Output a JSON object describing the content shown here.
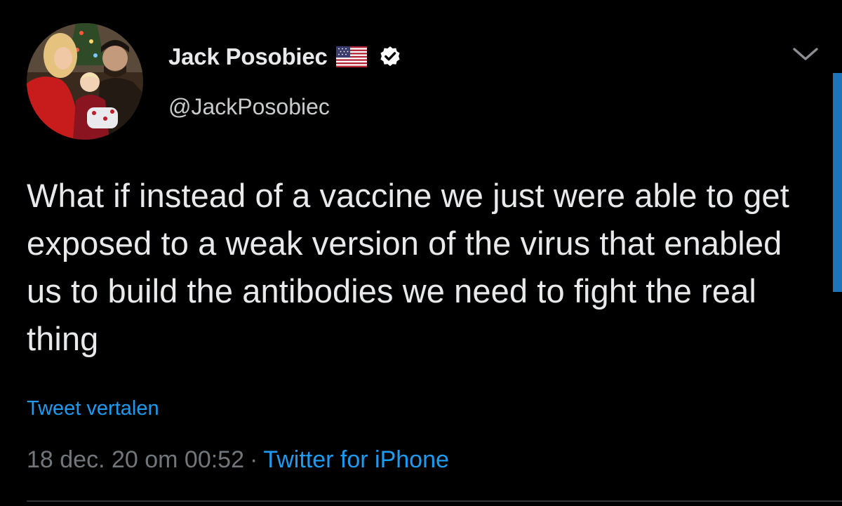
{
  "tweet": {
    "author": {
      "display_name": "Jack Posobiec",
      "handle": "@JackPosobiec",
      "flag_icon": "us-flag-icon",
      "verified_icon": "verified-badge-icon"
    },
    "text": "What if instead of a vaccine we just were able to get exposed to a weak version of the virus that enabled us to build the antibodies we need to fight the real thing",
    "translate_label": "Tweet vertalen",
    "timestamp": "18 dec. 20 om 00:52",
    "separator": "·",
    "source": "Twitter for iPhone",
    "more_icon": "chevron-down-icon"
  },
  "colors": {
    "background": "#000000",
    "primary_text": "#e7e9ea",
    "secondary_text": "#71767b",
    "link": "#1d9bf0",
    "scroll_indicator": "#1d74b8"
  }
}
